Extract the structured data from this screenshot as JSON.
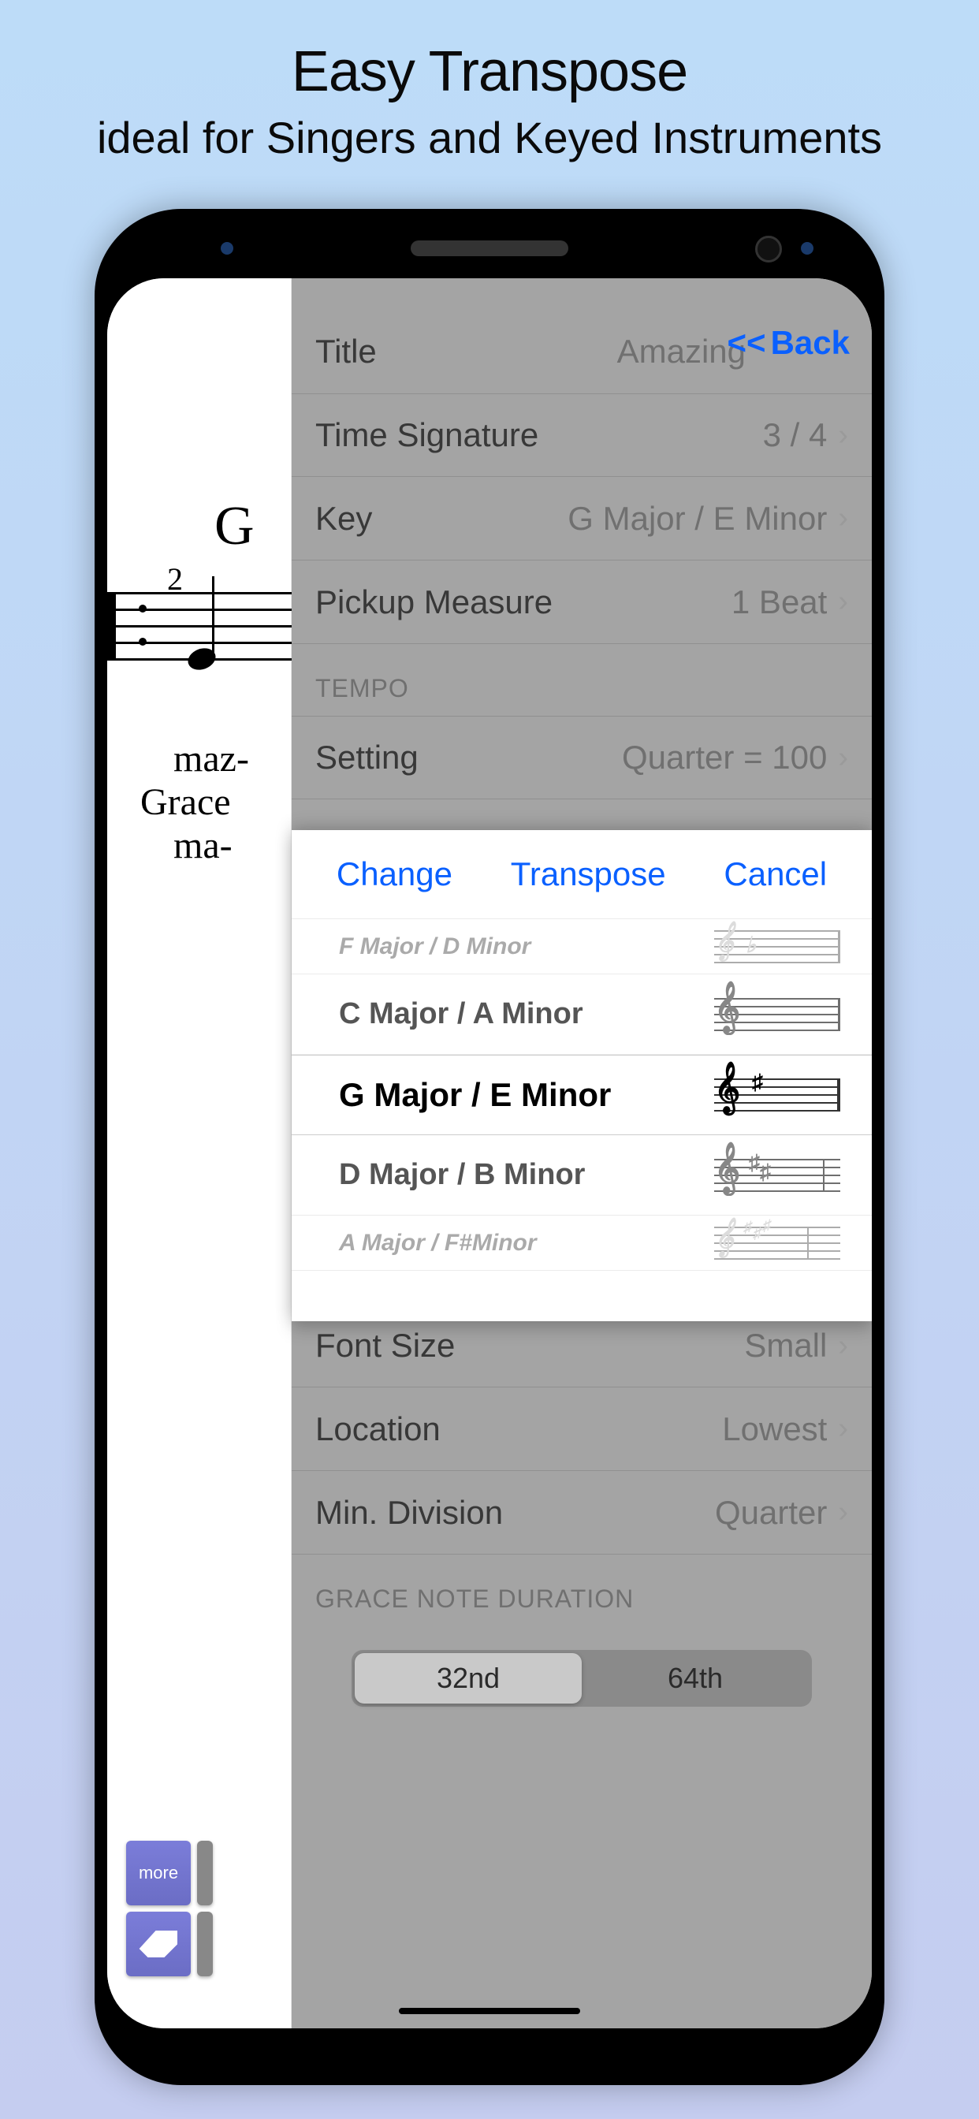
{
  "promo": {
    "title": "Easy Transpose",
    "subtitle": "ideal for Singers and Keyed Instruments"
  },
  "sheet": {
    "chord": "G",
    "pickup_number": "2",
    "lyrics": [
      "maz-",
      "Grace",
      "ma-"
    ]
  },
  "settings": {
    "title_label": "Title",
    "title_value": "Amazing",
    "back_label": "Back",
    "time_signature_label": "Time Signature",
    "time_signature_value": "3 / 4",
    "key_label": "Key",
    "key_value": "G Major / E Minor",
    "pickup_label": "Pickup Measure",
    "pickup_value": "1 Beat",
    "tempo_header": "TEMPO",
    "setting_label": "Setting",
    "setting_value": "Quarter = 100",
    "font_size_label": "Font Size",
    "font_size_value": "Small",
    "location_label": "Location",
    "location_value": "Lowest",
    "min_division_label": "Min. Division",
    "min_division_value": "Quarter",
    "grace_header": "GRACE NOTE DURATION",
    "seg_32": "32nd",
    "seg_64": "64th"
  },
  "action": {
    "change": "Change",
    "transpose": "Transpose",
    "cancel": "Cancel",
    "keys": [
      "F Major / D Minor",
      "C Major / A Minor",
      "G Major / E Minor",
      "D Major / B Minor",
      "A Major / F#Minor"
    ]
  },
  "toolbar": {
    "more": "more"
  }
}
